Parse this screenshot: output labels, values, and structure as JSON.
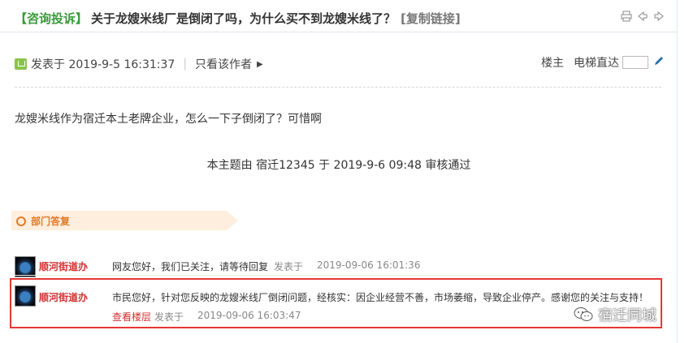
{
  "header": {
    "category": "【咨询投诉】",
    "title": "关于龙嫂米线厂是倒闭了吗，为什么买不到龙嫂米线了？",
    "copy_link": "[复制链接]"
  },
  "meta": {
    "posted": "发表于 2019-9-5 16:31:37",
    "separator": "|",
    "author_only": "只看该作者",
    "floor_label": "楼主",
    "floor_jump": "电梯直达"
  },
  "post": {
    "content": "龙嫂米线作为宿迁本土老牌企业，怎么一下子倒闭了？可惜啊",
    "audit": "本主题由 宿迁12345 于 2019-9-6 09:48 审核通过"
  },
  "department": {
    "label": "部门答复"
  },
  "replies": [
    {
      "name": "顺河街道办",
      "text": "网友您好，我们已关注，请等待回复",
      "posted_label": "发表于",
      "time": "2019-09-06 16:01:36"
    },
    {
      "name": "顺河街道办",
      "text": "市民您好，针对您反映的龙嫂米线厂倒闭问题，经核实：因企业经营不善，市场萎缩，导致企业停产。感谢您的关注与支持！",
      "view_floor": "查看楼层",
      "posted_label": "发表于",
      "time": "2019-09-06 16:03:47"
    }
  ],
  "watermark": {
    "text": "宿迁同城"
  },
  "colors": {
    "category_green": "#3a9a3a",
    "reply_red": "#d32f2f",
    "dept_orange": "#e07a2b",
    "highlight_border": "#e53935"
  }
}
